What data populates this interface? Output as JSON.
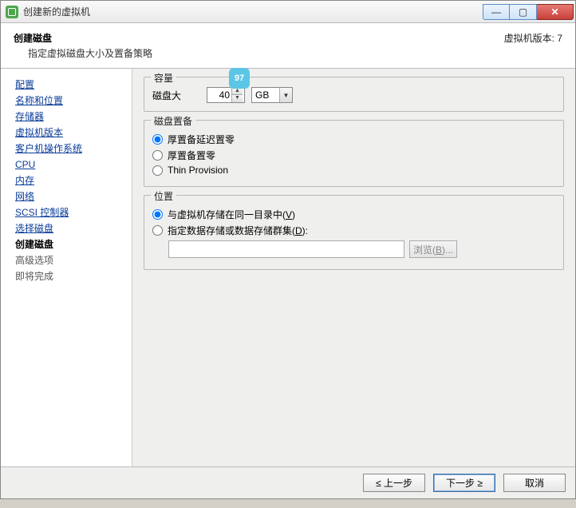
{
  "window": {
    "title": "创建新的虚拟机"
  },
  "header": {
    "title": "创建磁盘",
    "subtitle": "指定虚拟磁盘大小及置备策略",
    "version_label": "虚拟机版本: 7"
  },
  "sidebar": {
    "items": [
      {
        "label": "配置"
      },
      {
        "label": "名称和位置"
      },
      {
        "label": "存储器"
      },
      {
        "label": "虚拟机版本"
      },
      {
        "label": "客户机操作系统"
      },
      {
        "label": "CPU"
      },
      {
        "label": "内存"
      },
      {
        "label": "网络"
      },
      {
        "label": "SCSI 控制器"
      },
      {
        "label": "选择磁盘"
      },
      {
        "label": "创建磁盘"
      },
      {
        "label": "高级选项"
      },
      {
        "label": "即将完成"
      }
    ]
  },
  "capacity": {
    "legend": "容量",
    "size_label": "磁盘大",
    "size_value": "40",
    "unit_value": "GB",
    "badge": "97"
  },
  "provision": {
    "legend": "磁盘置备",
    "options": [
      {
        "label": "厚置备延迟置零"
      },
      {
        "label": "厚置备置零"
      },
      {
        "label": "Thin Provision"
      }
    ]
  },
  "location": {
    "legend": "位置",
    "opt1_prefix": "与虚拟机存储在同一目录中(",
    "opt1_key": "V",
    "opt1_suffix": ")",
    "opt2_prefix": "指定数据存储或数据存储群集(",
    "opt2_key": "D",
    "opt2_suffix": "):",
    "browse_prefix": "浏览(",
    "browse_key": "B",
    "browse_suffix": ")..."
  },
  "footer": {
    "back": "≤ 上一步",
    "next": "下一步 ≥",
    "cancel": "取消"
  }
}
